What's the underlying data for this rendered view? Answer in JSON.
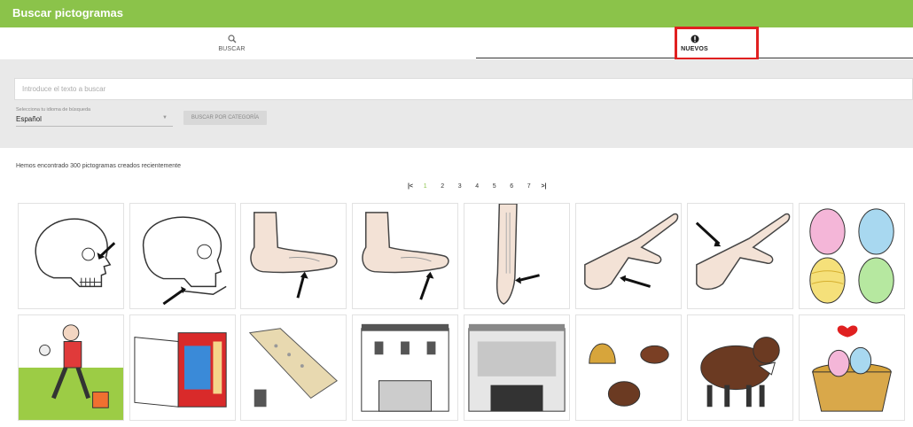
{
  "header": {
    "title": "Buscar pictogramas"
  },
  "tabs": [
    {
      "label": "BUSCAR",
      "icon": "search-icon"
    },
    {
      "label": "NUEVOS",
      "icon": "new-badge-icon"
    }
  ],
  "search": {
    "placeholder": "Introduce el texto a buscar"
  },
  "language": {
    "label": "Selecciona tu idioma de búsqueda",
    "value": "Español"
  },
  "category_button": "BUSCAR POR CATEGORÍA",
  "results_text": "Hemos encontrado 300 pictogramas creados recientemente",
  "pagination": {
    "first": "|<",
    "last": ">|",
    "pages": [
      "1",
      "2",
      "3",
      "4",
      "5",
      "6",
      "7"
    ],
    "current": "1"
  },
  "colors": {
    "accent": "#8bc34a",
    "highlight": "#e02020"
  },
  "pictograms": [
    "skull-jaw-pictogram",
    "skull-mandible-pictogram",
    "foot-sole-pictogram",
    "foot-toe-pictogram",
    "leg-ankle-pictogram",
    "hand-knuckle-pictogram",
    "hand-finger-pictogram",
    "easter-eggs-pictogram",
    "girl-sports-pictogram",
    "interactive-book-pictogram",
    "mattress-pictogram",
    "building-facade-pictogram",
    "theater-building-pictogram",
    "bell-rabbit-hen-pictogram",
    "lamb-pictogram",
    "egg-basket-pictogram"
  ]
}
